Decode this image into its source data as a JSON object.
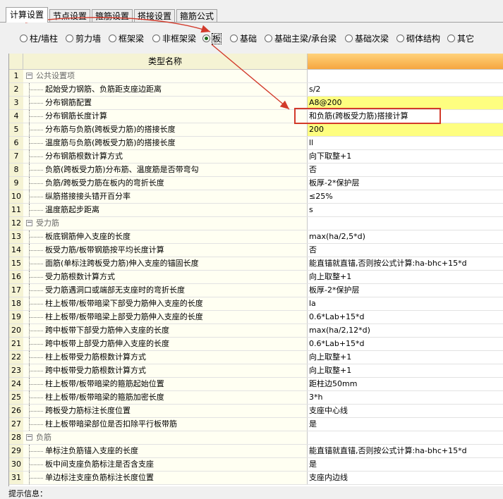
{
  "tabs": [
    {
      "label": "计算设置",
      "active": true
    },
    {
      "label": "节点设置",
      "active": false
    },
    {
      "label": "箍筋设置",
      "active": false
    },
    {
      "label": "搭接设置",
      "active": false
    },
    {
      "label": "箍筋公式",
      "active": false
    }
  ],
  "radios": [
    {
      "label": "柱/墙柱",
      "checked": false
    },
    {
      "label": "剪力墙",
      "checked": false
    },
    {
      "label": "框架梁",
      "checked": false
    },
    {
      "label": "非框架梁",
      "checked": false
    },
    {
      "label": "板",
      "checked": true
    },
    {
      "label": "基础",
      "checked": false
    },
    {
      "label": "基础主梁/承台梁",
      "checked": false
    },
    {
      "label": "基础次梁",
      "checked": false
    },
    {
      "label": "砌体结构",
      "checked": false
    },
    {
      "label": "其它",
      "checked": false
    }
  ],
  "grid": {
    "header_name": "类型名称",
    "rows": [
      {
        "num": "1",
        "name": "公共设置项",
        "value": "",
        "group": true
      },
      {
        "num": "2",
        "name": "起始受力钢筋、负筋距支座边距离",
        "value": "s/2"
      },
      {
        "num": "3",
        "name": "分布钢筋配置",
        "value": "A8@200",
        "highlight": true
      },
      {
        "num": "4",
        "name": "分布钢筋长度计算",
        "value": "和负筋(跨板受力筋)搭接计算"
      },
      {
        "num": "5",
        "name": "分布筋与负筋(跨板受力筋)的搭接长度",
        "value": "200",
        "highlight": true
      },
      {
        "num": "6",
        "name": "温度筋与负筋(跨板受力筋)的搭接长度",
        "value": "ll"
      },
      {
        "num": "7",
        "name": "分布钢筋根数计算方式",
        "value": "向下取整+1"
      },
      {
        "num": "8",
        "name": "负筋(跨板受力筋)分布筋、温度筋是否带弯勾",
        "value": "否"
      },
      {
        "num": "9",
        "name": "负筋/跨板受力筋在板内的弯折长度",
        "value": "板厚-2*保护层"
      },
      {
        "num": "10",
        "name": "纵筋搭接接头错开百分率",
        "value": "≤25%"
      },
      {
        "num": "11",
        "name": "温度筋起步距离",
        "value": "s"
      },
      {
        "num": "12",
        "name": "受力筋",
        "value": "",
        "group": true
      },
      {
        "num": "13",
        "name": "板底钢筋伸入支座的长度",
        "value": "max(ha/2,5*d)"
      },
      {
        "num": "14",
        "name": "板受力筋/板带钢筋按平均长度计算",
        "value": "否"
      },
      {
        "num": "15",
        "name": "面筋(单标注跨板受力筋)伸入支座的锚固长度",
        "value": "能直锚就直锚,否则按公式计算:ha-bhc+15*d"
      },
      {
        "num": "16",
        "name": "受力筋根数计算方式",
        "value": "向上取整+1"
      },
      {
        "num": "17",
        "name": "受力筋遇洞口或端部无支座时的弯折长度",
        "value": "板厚-2*保护层"
      },
      {
        "num": "18",
        "name": "柱上板带/板带暗梁下部受力筋伸入支座的长度",
        "value": "la"
      },
      {
        "num": "19",
        "name": "柱上板带/板带暗梁上部受力筋伸入支座的长度",
        "value": "0.6*Lab+15*d"
      },
      {
        "num": "20",
        "name": "跨中板带下部受力筋伸入支座的长度",
        "value": "max(ha/2,12*d)"
      },
      {
        "num": "21",
        "name": "跨中板带上部受力筋伸入支座的长度",
        "value": "0.6*Lab+15*d"
      },
      {
        "num": "22",
        "name": "柱上板带受力筋根数计算方式",
        "value": "向上取整+1"
      },
      {
        "num": "23",
        "name": "跨中板带受力筋根数计算方式",
        "value": "向上取整+1"
      },
      {
        "num": "24",
        "name": "柱上板带/板带暗梁的箍筋起始位置",
        "value": "距柱边50mm"
      },
      {
        "num": "25",
        "name": "柱上板带/板带暗梁的箍筋加密长度",
        "value": "3*h"
      },
      {
        "num": "26",
        "name": "跨板受力筋标注长度位置",
        "value": "支座中心线"
      },
      {
        "num": "27",
        "name": "柱上板带暗梁部位是否扣除平行板带筋",
        "value": "是"
      },
      {
        "num": "28",
        "name": "负筋",
        "value": "",
        "group": true
      },
      {
        "num": "29",
        "name": "单标注负筋锚入支座的长度",
        "value": "能直锚就直锚,否则按公式计算:ha-bhc+15*d"
      },
      {
        "num": "30",
        "name": "板中间支座负筋标注是否含支座",
        "value": "是"
      },
      {
        "num": "31",
        "name": "单边标注支座负筋标注长度位置",
        "value": "支座内边线"
      }
    ]
  },
  "status_text": "提示信息：",
  "colors": {
    "annotation_red": "#d23a2b",
    "header_orange": "#f6a640",
    "highlight_yellow": "#fefe80"
  }
}
